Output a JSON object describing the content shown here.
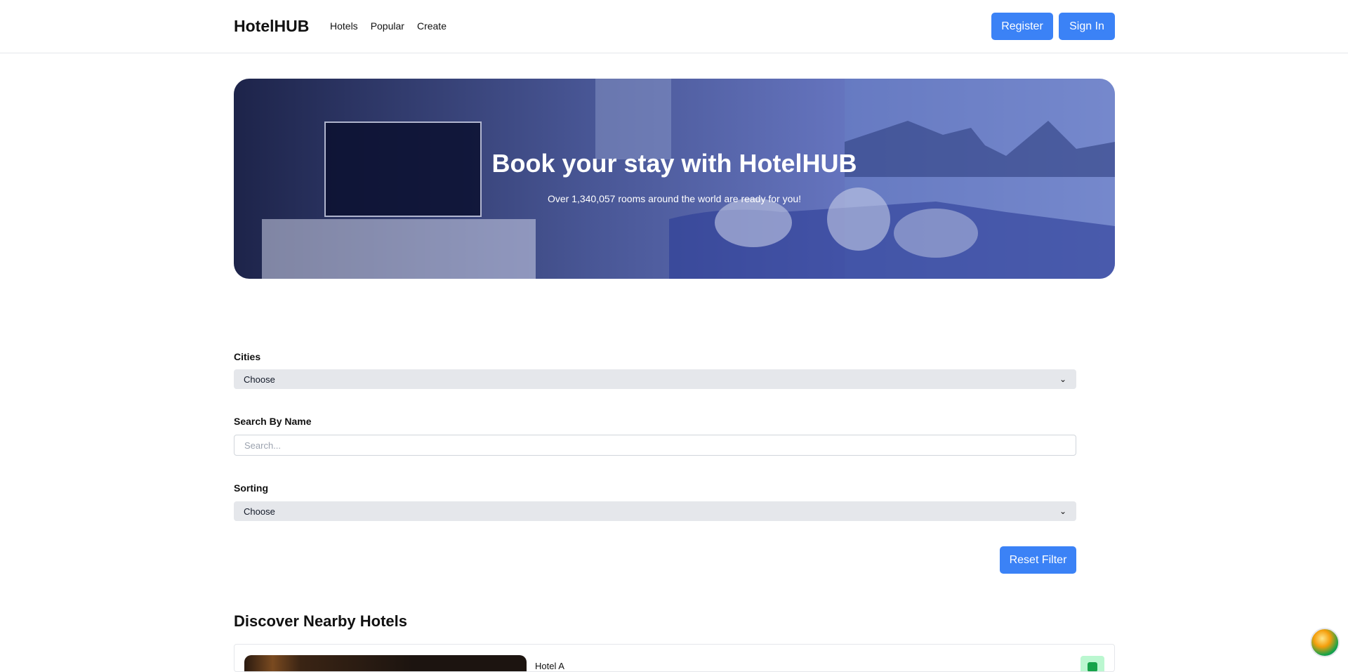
{
  "header": {
    "brand": "HotelHUB",
    "nav": [
      "Hotels",
      "Popular",
      "Create"
    ],
    "register_label": "Register",
    "signin_label": "Sign In"
  },
  "hero": {
    "title": "Book your stay with HotelHUB",
    "subtitle": "Over 1,340,057 rooms around the world are ready for you!"
  },
  "filters": {
    "cities_label": "Cities",
    "cities_value": "Choose",
    "search_label": "Search By Name",
    "search_placeholder": "Search...",
    "sorting_label": "Sorting",
    "sorting_value": "Choose",
    "reset_label": "Reset Filter"
  },
  "section": {
    "title": "Discover Nearby Hotels"
  },
  "hotels": [
    {
      "name": "Hotel A"
    }
  ],
  "colors": {
    "accent": "#3b82f6",
    "badge": "#bbf7d0",
    "badge_icon": "#16a34a"
  }
}
